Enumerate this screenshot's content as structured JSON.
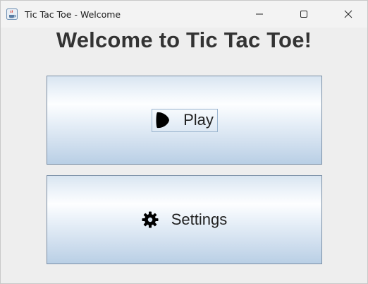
{
  "window": {
    "title": "Tic Tac Toe - Welcome",
    "app_icon": "java-coffee-cup-icon",
    "controls": [
      "minimize-icon",
      "maximize-icon",
      "close-icon"
    ]
  },
  "main": {
    "heading": "Welcome to Tic Tac Toe!",
    "buttons": [
      {
        "label": "Play",
        "icon": "play-icon",
        "focused": true
      },
      {
        "label": "Settings",
        "icon": "gear-icon",
        "focused": false
      }
    ]
  },
  "colors": {
    "heading_text": "#333333",
    "button_border": "#7a8fa6",
    "button_gradient_top": "#d9e5f1",
    "button_gradient_bottom": "#b9cfe5"
  }
}
